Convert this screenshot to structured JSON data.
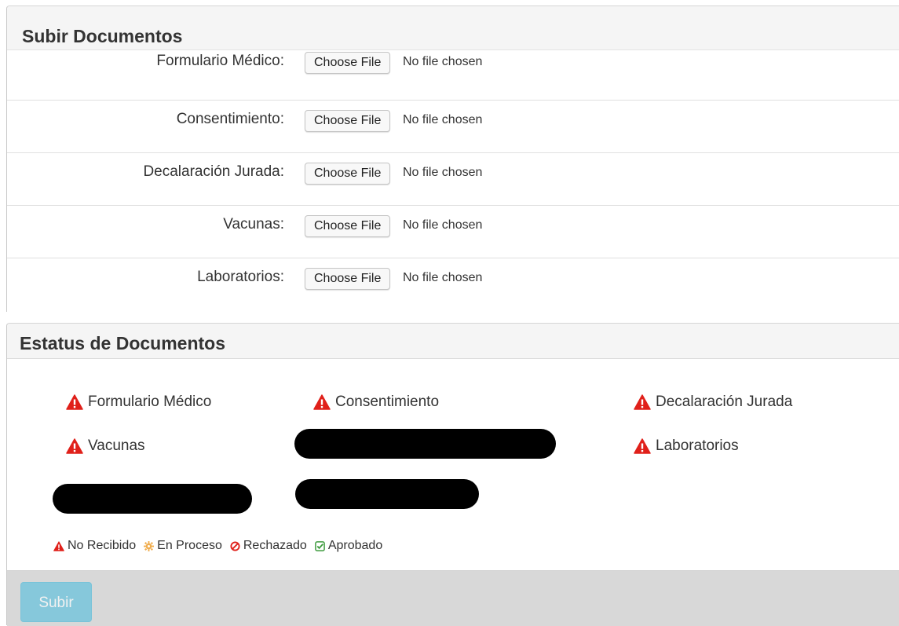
{
  "upload": {
    "title": "Subir Documentos",
    "rows": [
      {
        "label": "Formulario Médico:",
        "button": "Choose File",
        "status": "No file chosen"
      },
      {
        "label": "Consentimiento:",
        "button": "Choose File",
        "status": "No file chosen"
      },
      {
        "label": "Decalaración Jurada:",
        "button": "Choose File",
        "status": "No file chosen"
      },
      {
        "label": "Vacunas:",
        "button": "Choose File",
        "status": "No file chosen"
      },
      {
        "label": "Laboratorios:",
        "button": "Choose File",
        "status": "No file chosen"
      }
    ]
  },
  "status": {
    "title": "Estatus de Documentos",
    "items": [
      {
        "label": "Formulario Médico",
        "icon": "warning-icon"
      },
      {
        "label": "Consentimiento",
        "icon": "warning-icon"
      },
      {
        "label": "Decalaración Jurada",
        "icon": "warning-icon"
      },
      {
        "label": "Vacunas",
        "icon": "warning-icon"
      },
      {
        "label": "Laboratorios",
        "icon": "warning-icon"
      }
    ],
    "legend": [
      {
        "label": "No Recibido",
        "icon": "warning-icon",
        "color": "#e0201a"
      },
      {
        "label": "En Proceso",
        "icon": "gear-icon",
        "color": "#f0ad4e"
      },
      {
        "label": "Rechazado",
        "icon": "ban-icon",
        "color": "#e0201a"
      },
      {
        "label": "Aprobado",
        "icon": "check-square-icon",
        "color": "#3c9a3c"
      }
    ]
  },
  "footer": {
    "submit_label": "Subir"
  },
  "colors": {
    "warning": "#e0201a",
    "button_info": "#5bc0de"
  }
}
